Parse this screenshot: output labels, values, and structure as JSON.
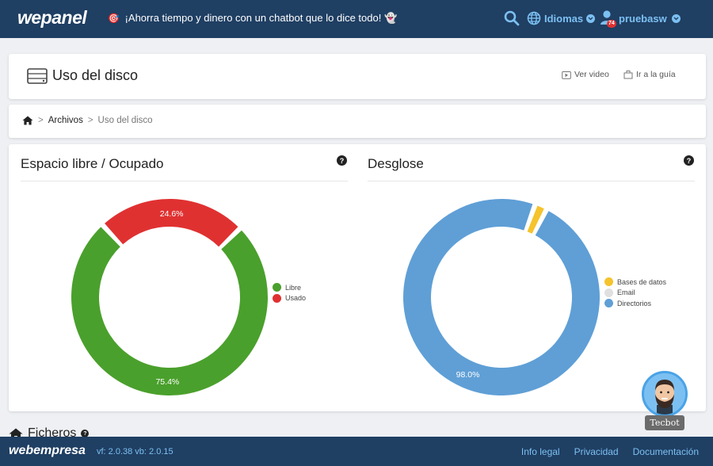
{
  "header": {
    "logo": "wepanel",
    "promo_icon": "🎯",
    "promo_text": "¡Ahorra tiempo y dinero con un chatbot que lo dice todo! 👻",
    "language_label": "Idiomas",
    "username": "pruebasw",
    "notification_count": "74"
  },
  "page": {
    "title": "Uso del disco",
    "video_link": "Ver video",
    "guide_link": "Ir a la guía"
  },
  "breadcrumb": {
    "items": [
      "Archivos",
      "Uso del disco"
    ]
  },
  "panels": {
    "left_title": "Espacio libre / Ocupado",
    "right_title": "Desglose",
    "help_glyph": "?"
  },
  "chart_data": [
    {
      "type": "pie",
      "title": "Espacio libre / Ocupado",
      "categories": [
        "Libre",
        "Usado"
      ],
      "values": [
        75.4,
        24.6
      ],
      "labels": [
        "75.4%",
        "24.6%"
      ],
      "colors": [
        "#4aa02c",
        "#e03131"
      ],
      "legend": "right"
    },
    {
      "type": "pie",
      "title": "Desglose",
      "categories": [
        "Bases de datos",
        "Email",
        "Directorios"
      ],
      "values": [
        2.0,
        0.0,
        98.0
      ],
      "labels": [
        "",
        "",
        "98.0%"
      ],
      "colors": [
        "#f5c32c",
        "#e0e0e0",
        "#5f9fd6"
      ],
      "legend": "right"
    }
  ],
  "section": {
    "ficheros": "Ficheros"
  },
  "tecbot": {
    "label": "Tecbot"
  },
  "footer": {
    "brand": "webempresa",
    "version": "vf: 2.0.38 vb: 2.0.15",
    "links": [
      "Info legal",
      "Privacidad",
      "Documentación"
    ]
  },
  "colors": {
    "navy": "#1f3f63",
    "accent": "#7cc0f2"
  }
}
